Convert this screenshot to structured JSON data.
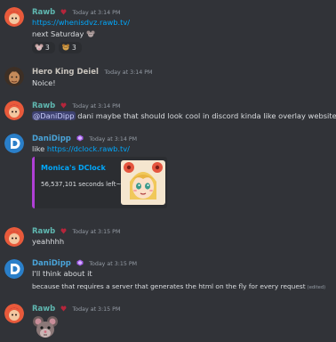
{
  "messages": {
    "m1": {
      "author": "Rawb",
      "timestamp": "Today at 3:14 PM",
      "link": "https://whenisdvz.rawb.tv/",
      "text": "next Saturday",
      "reactions": [
        {
          "emoji": "mouse-emoji",
          "count": "3"
        },
        {
          "emoji": "rat-face-emoji",
          "count": "3"
        }
      ]
    },
    "m2": {
      "author": "Hero King Deiel",
      "timestamp": "Today at 3:14 PM",
      "text": "Noice!"
    },
    "m3": {
      "author": "Rawb",
      "timestamp": "Today at 3:14 PM",
      "mention": "@DaniDipp",
      "text": " dani maybe that should look cool in discord kinda like overlay websites"
    },
    "m4": {
      "author": "DaniDipp",
      "timestamp": "Today at 3:14 PM",
      "text_prefix": "like ",
      "link": "https://dclock.rawb.tv/",
      "embed": {
        "title": "Monica's DClock",
        "description": "56,537,101 seconds left~"
      }
    },
    "m5": {
      "author": "Rawb",
      "timestamp": "Today at 3:15 PM",
      "text": "yeahhhh"
    },
    "m6": {
      "author": "DaniDipp",
      "timestamp": "Today at 3:15 PM",
      "text1": "I'll think about it",
      "text2": "because that requires a server that generates the html on the fly for every request",
      "edited": "(edited)"
    },
    "m7": {
      "author": "Rawb",
      "timestamp": "Today at 3:15 PM"
    }
  },
  "colors": {
    "background": "#313338",
    "rawb_name": "#5fb7b0",
    "dani_name": "#49a3d8",
    "link": "#00a8fc",
    "embed_accent": "#b03fd6"
  }
}
